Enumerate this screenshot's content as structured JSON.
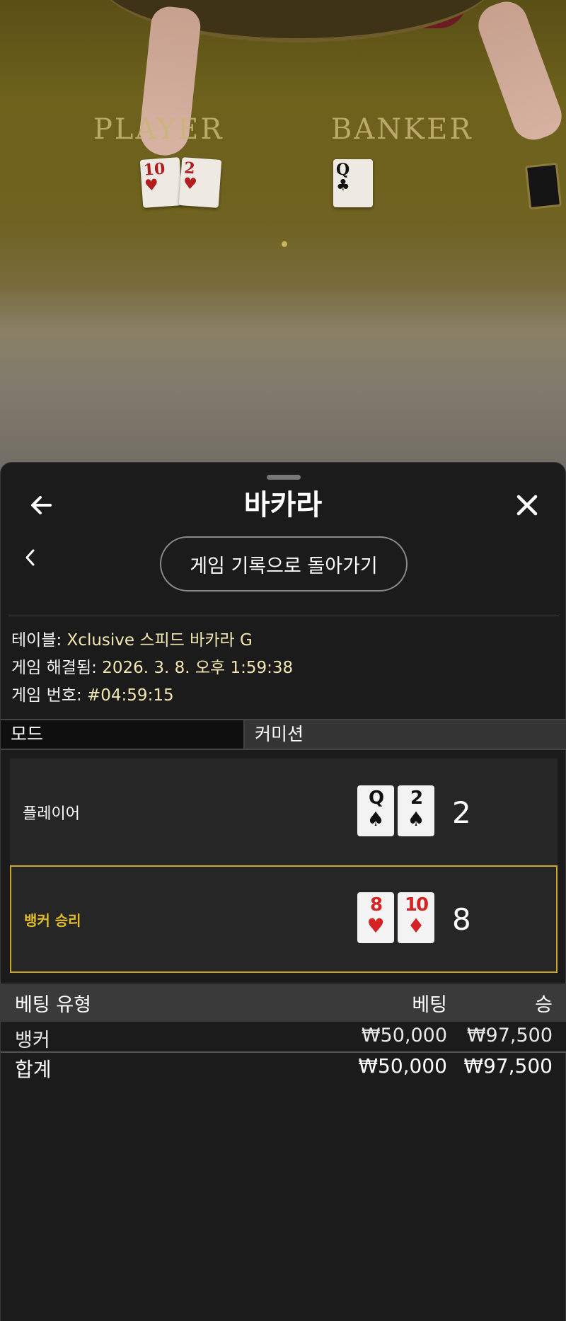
{
  "video": {
    "player_word": "PLAYER",
    "banker_word": "BANKER",
    "player_cards": [
      {
        "rank": "10",
        "suit": "♥"
      },
      {
        "rank": "2",
        "suit": "♥"
      }
    ],
    "banker_cards": [
      {
        "rank": "Q",
        "suit": "♣"
      }
    ]
  },
  "header": {
    "title": "바카라",
    "back_icon": "arrow-left-icon",
    "close_icon": "close-icon"
  },
  "nav": {
    "prev_icon": "chevron-left-icon",
    "history_button": "게임 기록으로 돌아가기"
  },
  "info": {
    "table_label": "테이블:",
    "table_value": "Xclusive 스피드 바카라 G",
    "resolved_label": "게임 해결됨:",
    "resolved_value": "2026. 3. 8. 오후 1:59:38",
    "number_label": "게임 번호:",
    "number_value": "#04:59:15"
  },
  "tabs": {
    "mode": "모드",
    "commission": "커미션"
  },
  "hands": {
    "player": {
      "label": "플레이어",
      "total": "2",
      "cards": [
        {
          "rank": "Q",
          "suit": "♠",
          "color": "black"
        },
        {
          "rank": "2",
          "suit": "♠",
          "color": "black"
        }
      ]
    },
    "banker": {
      "label": "뱅커 승리",
      "total": "8",
      "cards": [
        {
          "rank": "8",
          "suit": "♥",
          "color": "red"
        },
        {
          "rank": "10",
          "suit": "♦",
          "color": "red"
        }
      ]
    }
  },
  "bets": {
    "headers": {
      "type": "베팅 유형",
      "bet": "베팅",
      "win": "승"
    },
    "rows": [
      {
        "type": "뱅커",
        "bet": "₩50,000",
        "win": "₩97,500"
      }
    ],
    "total": {
      "type": "합계",
      "bet": "₩50,000",
      "win": "₩97,500"
    }
  },
  "colors": {
    "sheet_bg": "#1b1b1b",
    "winner_border": "#c9a521",
    "winner_text": "#e1bd2b",
    "info_value": "#f2e6b0"
  }
}
